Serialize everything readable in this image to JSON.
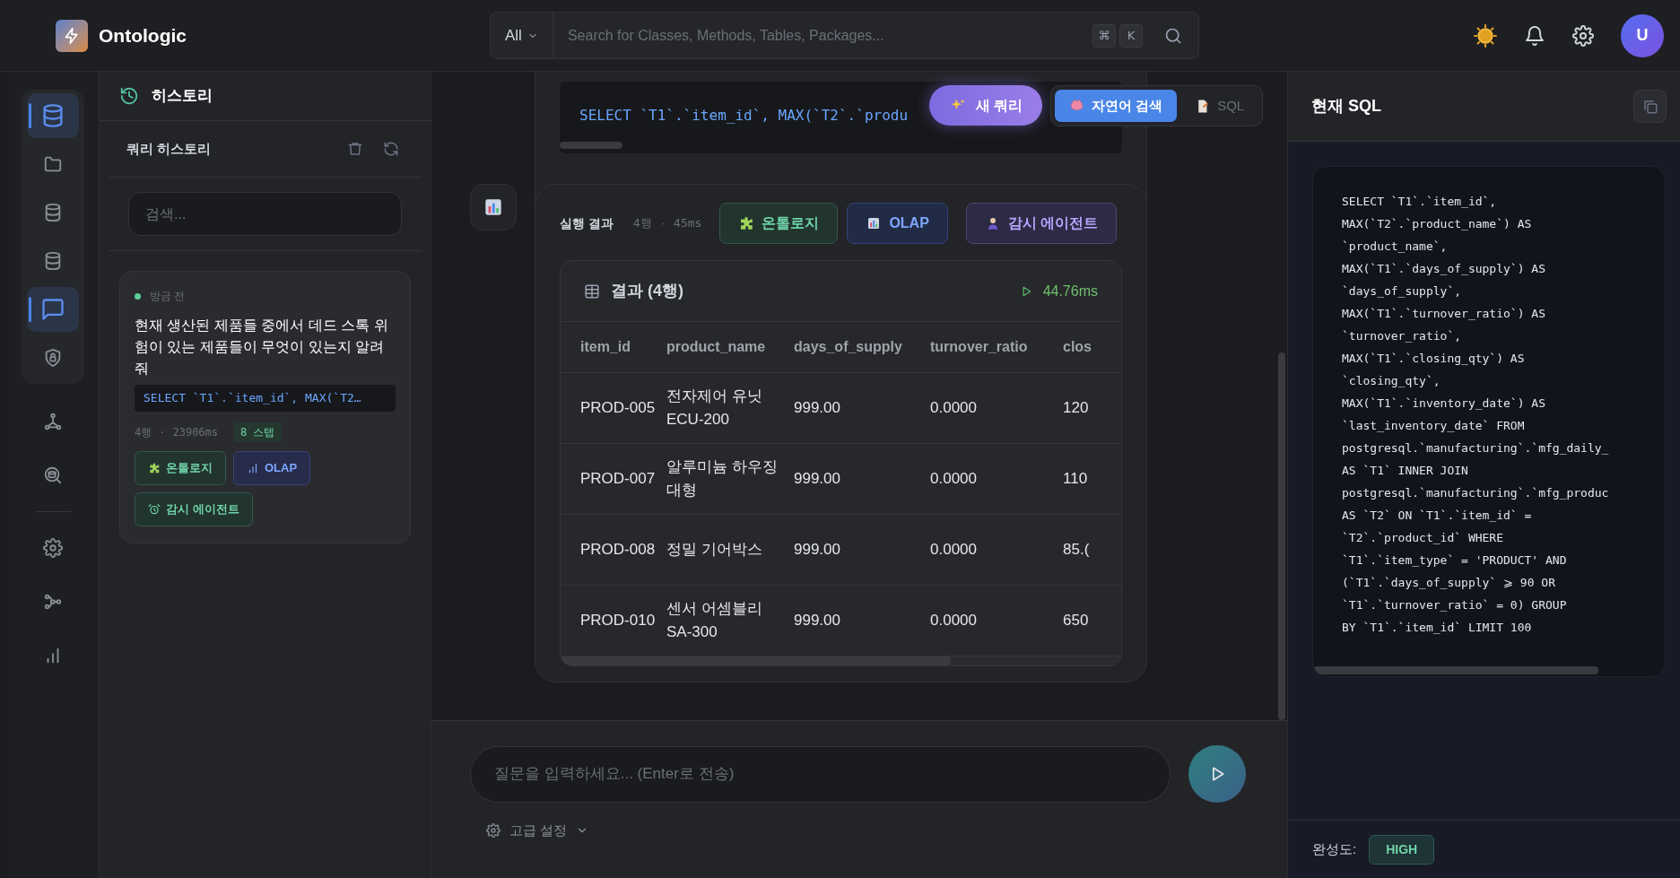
{
  "header": {
    "logo_text": "Ontologic",
    "search": {
      "scope": "All",
      "placeholder": "Search for Classes, Methods, Tables, Packages...",
      "shortcut_keys": [
        "⌘",
        "K"
      ]
    },
    "avatar": "U"
  },
  "rail": {
    "group": [
      {
        "kind": "database",
        "selected": true
      },
      {
        "kind": "folder",
        "selected": false
      },
      {
        "kind": "database",
        "selected": false
      },
      {
        "kind": "database",
        "selected": false
      },
      {
        "kind": "chat",
        "selected": true
      },
      {
        "kind": "shield",
        "selected": false
      }
    ],
    "items": [
      {
        "kind": "graph",
        "selected": false
      },
      {
        "kind": "search",
        "selected": false
      },
      {
        "kind": "divider"
      },
      {
        "kind": "settings",
        "selected": false
      },
      {
        "kind": "workflow",
        "selected": false
      },
      {
        "kind": "chart",
        "selected": false
      }
    ]
  },
  "history_panel": {
    "title": "히스토리",
    "subtitle": "쿼리 히스토리",
    "search_placeholder": "검색...",
    "items": [
      {
        "time": "방금 전",
        "question": "현재 생산된 제품들 중에서 데드 스톡 위험이 있는 제품들이 무엇이 있는지 알려줘",
        "sql": "SELECT `T1`.`item_id`, MAX(`T2…",
        "rows": "4행",
        "separator": "·",
        "duration": "23906ms",
        "steps": "8 스텝",
        "tags": [
          {
            "kind": "ontology",
            "label": "온톨로지"
          },
          {
            "kind": "olap",
            "label": "OLAP"
          },
          {
            "kind": "agent",
            "label": "감시 에이전트"
          }
        ]
      }
    ]
  },
  "chat": {
    "sql_preview": "SELECT `T1`.`item_id`, MAX(`T2`.`produ",
    "new_query_button": "새 쿼리",
    "mode_toggle": [
      {
        "label": "자연어 검색",
        "selected": true
      },
      {
        "label": "SQL",
        "selected": false
      }
    ],
    "result": {
      "label": "실행 결과",
      "rows": "4행",
      "separator": "·",
      "duration": "45ms",
      "actions": [
        {
          "kind": "ontology",
          "label": "온톨로지"
        },
        {
          "kind": "olap",
          "label": "OLAP"
        },
        {
          "kind": "agent",
          "label": "감시 에이전트"
        }
      ],
      "table": {
        "title": "결과 (4행)",
        "time": "44.76ms",
        "columns": [
          "item_id",
          "product_name",
          "days_of_supply",
          "turnover_ratio",
          "clos"
        ],
        "rows": [
          [
            "PROD-005",
            "전자제어 유닛 ECU-200",
            "999.00",
            "0.0000",
            "120"
          ],
          [
            "PROD-007",
            "알루미늄 하우징 대형",
            "999.00",
            "0.0000",
            "110"
          ],
          [
            "PROD-008",
            "정밀 기어박스",
            "999.00",
            "0.0000",
            "85.("
          ],
          [
            "PROD-010",
            "센서 어셈블리 SA-300",
            "999.00",
            "0.0000",
            "650"
          ]
        ]
      }
    },
    "composer": {
      "placeholder": "질문을 입력하세요... (Enter로 전송)",
      "advanced": "고급 설정"
    }
  },
  "sql_panel": {
    "title": "현재 SQL",
    "lines": [
      "SELECT `T1`.`item_id`,",
      "MAX(`T2`.`product_name`) AS",
      "`product_name`,",
      "MAX(`T1`.`days_of_supply`) AS",
      "`days_of_supply`,",
      "MAX(`T1`.`turnover_ratio`) AS",
      "`turnover_ratio`,",
      "MAX(`T1`.`closing_qty`) AS",
      "`closing_qty`,",
      "MAX(`T1`.`inventory_date`) AS",
      "`last_inventory_date` FROM",
      "postgresql.`manufacturing`.`mfg_daily_",
      "AS `T1` INNER JOIN",
      "postgresql.`manufacturing`.`mfg_produc",
      "AS `T2` ON `T1`.`item_id` =",
      "`T2`.`product_id` WHERE",
      "`T1`.`item_type` = 'PRODUCT' AND",
      "(`T1`.`days_of_supply` ⩾ 90 OR",
      "`T1`.`turnover_ratio` = 0) GROUP",
      "BY `T1`.`item_id` LIMIT 100"
    ],
    "completeness_label": "완성도:",
    "completeness": "HIGH"
  }
}
